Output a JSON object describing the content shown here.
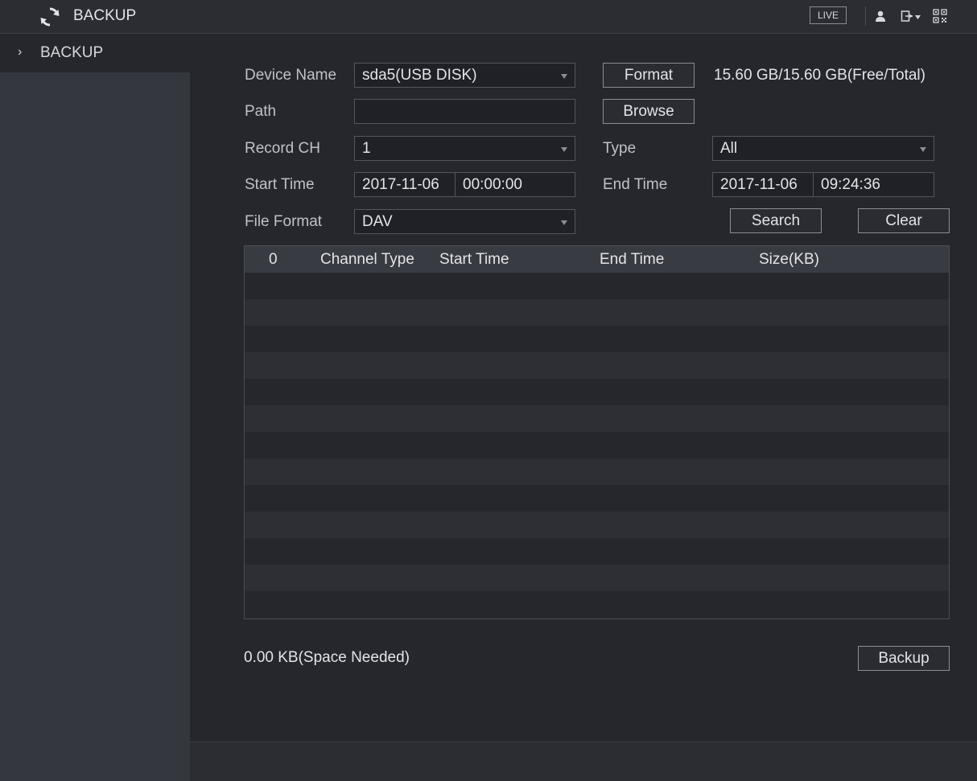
{
  "header": {
    "title": "BACKUP",
    "live_label": "LIVE"
  },
  "sidebar": {
    "items": [
      {
        "label": "BACKUP"
      }
    ]
  },
  "form": {
    "device_name": {
      "label": "Device Name",
      "value": "sda5(USB DISK)"
    },
    "format_button": "Format",
    "capacity": "15.60 GB/15.60 GB(Free/Total)",
    "path": {
      "label": "Path",
      "value": ""
    },
    "browse_button": "Browse",
    "record_ch": {
      "label": "Record CH",
      "value": "1"
    },
    "type": {
      "label": "Type",
      "value": "All"
    },
    "start_time": {
      "label": "Start Time",
      "date": "2017-11-06",
      "time": "00:00:00"
    },
    "end_time": {
      "label": "End Time",
      "date": "2017-11-06",
      "time": "09:24:36"
    },
    "file_format": {
      "label": "File Format",
      "value": "DAV"
    },
    "search_button": "Search",
    "clear_button": "Clear"
  },
  "table": {
    "columns": [
      "0",
      "Channel Type",
      "Start Time",
      "End Time",
      "Size(KB)"
    ],
    "rows": []
  },
  "footer": {
    "space_needed": "0.00 KB(Space Needed)",
    "backup_button": "Backup"
  },
  "icons": {
    "app": "refresh-icon",
    "user": "user-icon",
    "logout": "logout-icon",
    "qr": "qr-code-icon"
  }
}
